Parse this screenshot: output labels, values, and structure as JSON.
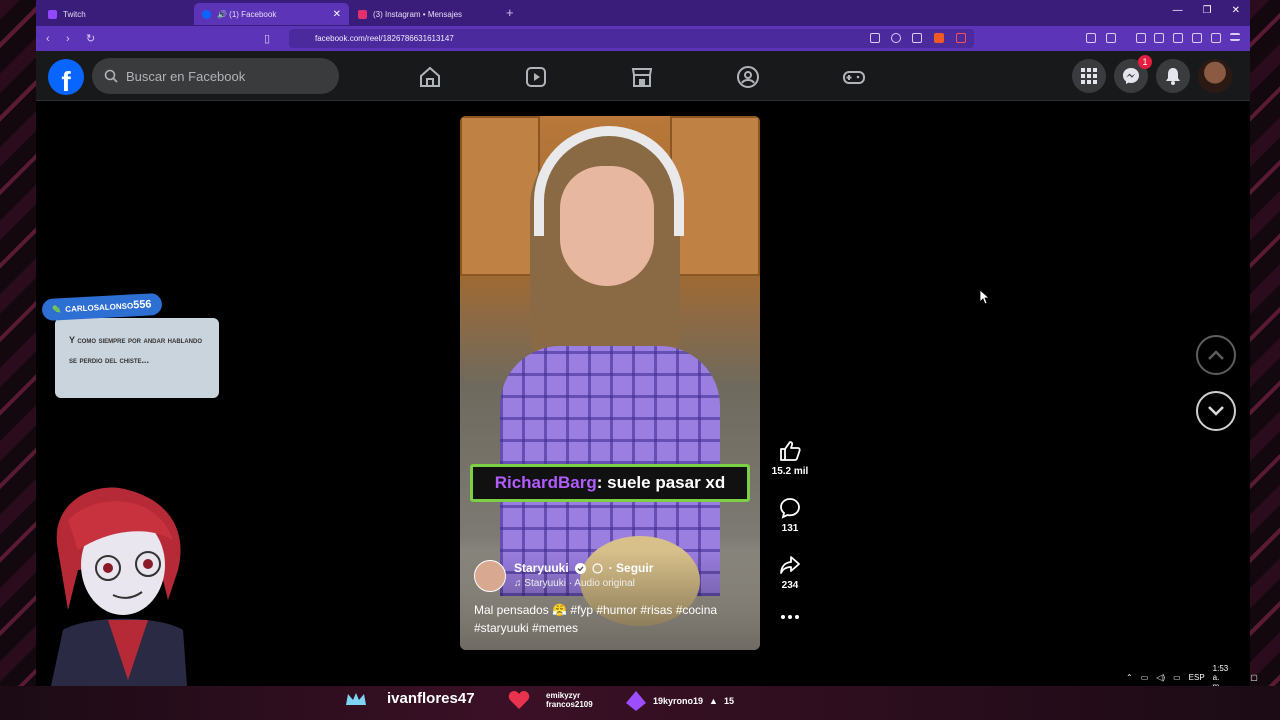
{
  "browser": {
    "tabs": [
      {
        "label": "Twitch",
        "favicon_color": "#9146ff",
        "active": false
      },
      {
        "label": "🔊 (1) Facebook",
        "favicon_color": "#0866ff",
        "active": true
      },
      {
        "label": "(3) Instagram • Mensajes",
        "favicon_color": "#e1306c",
        "active": false
      }
    ],
    "new_tab": "+",
    "url": "facebook.com/reel/1826786631613147"
  },
  "facebook": {
    "logo": "f",
    "search_placeholder": "Buscar en Facebook",
    "nav_icons": [
      "home-icon",
      "video-icon",
      "marketplace-icon",
      "groups-icon",
      "gaming-icon"
    ],
    "messenger_badge": "1"
  },
  "reel": {
    "stream_chat_user": "RichardBarg",
    "stream_chat_message": ": suele pasar xd",
    "author": "Staryuuki",
    "follow_label": "· Seguir",
    "audio": "♫ Staryuuki · Audio original",
    "caption": "Mal pensados 😤 #fyp #humor #risas #cocina #staryuuki #memes",
    "likes": "15.2 mil",
    "comments": "131",
    "shares": "234"
  },
  "overlay": {
    "chat_username": "carlosalonso556",
    "chat_message": "Y como siempre por andar hablando se perdio del chiste...",
    "bottom_bar": {
      "username": "ivanflores47",
      "sub_user_1": "emikyzyr",
      "sub_user_2": "francos2109",
      "bits_user": "19kyrono19",
      "bits_count": "15"
    }
  },
  "taskbar": {
    "lang": "ESP",
    "time": "1:53 a. m."
  },
  "colors": {
    "fb_blue": "#0866ff",
    "browser_purple": "#5b34b8",
    "chat_green": "#7bd043",
    "chat_user_purple": "#b05cff"
  }
}
